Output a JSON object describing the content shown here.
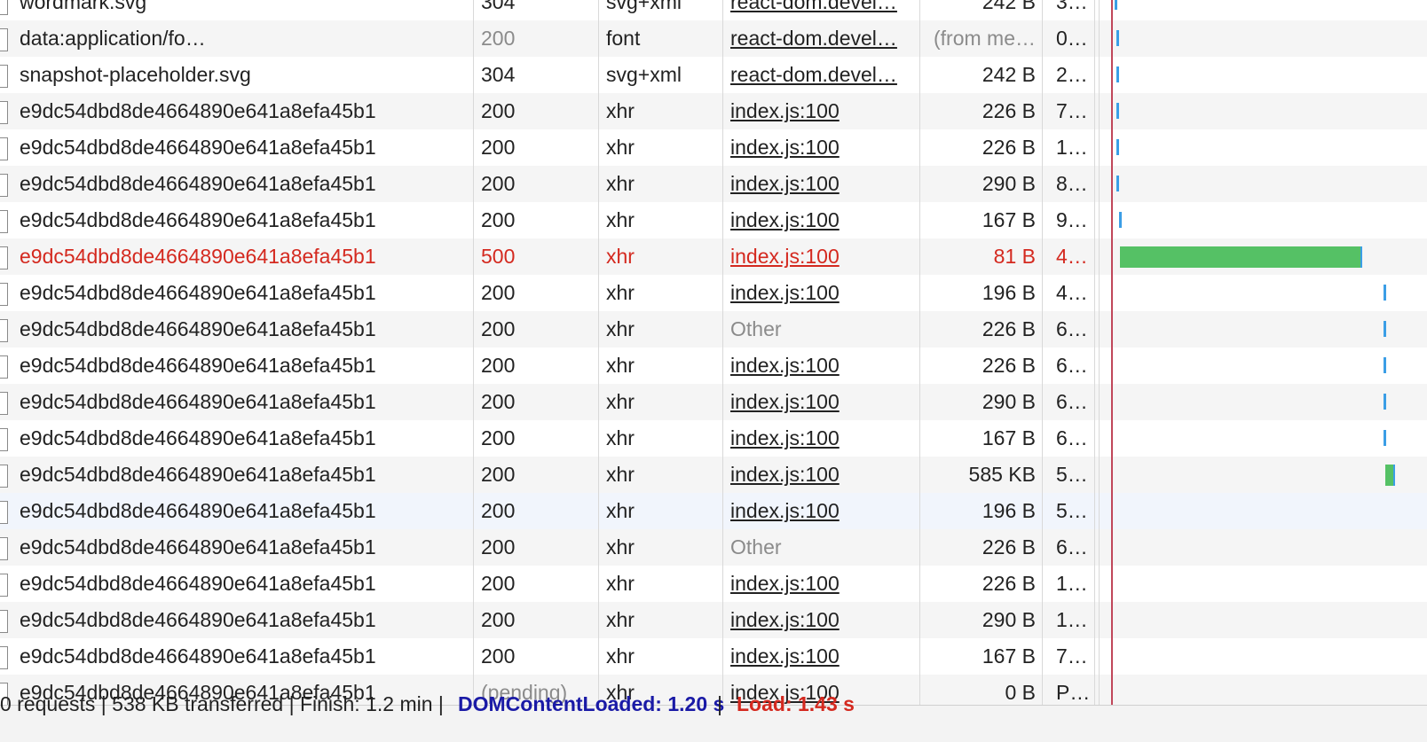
{
  "requests": [
    {
      "name": "wordmark.svg",
      "status": "304",
      "type": "svg+xml",
      "initiator": "react-dom.devel…",
      "size": "242 B",
      "time": "3…"
    },
    {
      "name": "data:application/fo…",
      "status": "200",
      "type": "font",
      "initiator": "react-dom.devel…",
      "size": "(from me…",
      "time": "0…"
    },
    {
      "name": "snapshot-placeholder.svg",
      "status": "304",
      "type": "svg+xml",
      "initiator": "react-dom.devel…",
      "size": "242 B",
      "time": "2…"
    },
    {
      "name": "e9dc54dbd8de4664890e641a8efa45b1",
      "status": "200",
      "type": "xhr",
      "initiator": "index.js:100",
      "size": "226 B",
      "time": "7…"
    },
    {
      "name": "e9dc54dbd8de4664890e641a8efa45b1",
      "status": "200",
      "type": "xhr",
      "initiator": "index.js:100",
      "size": "226 B",
      "time": "1…"
    },
    {
      "name": "e9dc54dbd8de4664890e641a8efa45b1",
      "status": "200",
      "type": "xhr",
      "initiator": "index.js:100",
      "size": "290 B",
      "time": "8…"
    },
    {
      "name": "e9dc54dbd8de4664890e641a8efa45b1",
      "status": "200",
      "type": "xhr",
      "initiator": "index.js:100",
      "size": "167 B",
      "time": "9…"
    },
    {
      "name": "e9dc54dbd8de4664890e641a8efa45b1",
      "status": "500",
      "type": "xhr",
      "initiator": "index.js:100",
      "size": "81 B",
      "time": "4…",
      "error": true
    },
    {
      "name": "e9dc54dbd8de4664890e641a8efa45b1",
      "status": "200",
      "type": "xhr",
      "initiator": "index.js:100",
      "size": "196 B",
      "time": "4…"
    },
    {
      "name": "e9dc54dbd8de4664890e641a8efa45b1",
      "status": "200",
      "type": "xhr",
      "initiator": "Other",
      "size": "226 B",
      "time": "6…"
    },
    {
      "name": "e9dc54dbd8de4664890e641a8efa45b1",
      "status": "200",
      "type": "xhr",
      "initiator": "index.js:100",
      "size": "226 B",
      "time": "6…"
    },
    {
      "name": "e9dc54dbd8de4664890e641a8efa45b1",
      "status": "200",
      "type": "xhr",
      "initiator": "index.js:100",
      "size": "290 B",
      "time": "6…"
    },
    {
      "name": "e9dc54dbd8de4664890e641a8efa45b1",
      "status": "200",
      "type": "xhr",
      "initiator": "index.js:100",
      "size": "167 B",
      "time": "6…"
    },
    {
      "name": "e9dc54dbd8de4664890e641a8efa45b1",
      "status": "200",
      "type": "xhr",
      "initiator": "index.js:100",
      "size": "585 KB",
      "time": "5…"
    },
    {
      "name": "e9dc54dbd8de4664890e641a8efa45b1",
      "status": "200",
      "type": "xhr",
      "initiator": "index.js:100",
      "size": "196 B",
      "time": "5…",
      "selected": true
    },
    {
      "name": "e9dc54dbd8de4664890e641a8efa45b1",
      "status": "200",
      "type": "xhr",
      "initiator": "Other",
      "size": "226 B",
      "time": "6…"
    },
    {
      "name": "e9dc54dbd8de4664890e641a8efa45b1",
      "status": "200",
      "type": "xhr",
      "initiator": "index.js:100",
      "size": "226 B",
      "time": "1…"
    },
    {
      "name": "e9dc54dbd8de4664890e641a8efa45b1",
      "status": "200",
      "type": "xhr",
      "initiator": "index.js:100",
      "size": "290 B",
      "time": "1…"
    },
    {
      "name": "e9dc54dbd8de4664890e641a8efa45b1",
      "status": "200",
      "type": "xhr",
      "initiator": "index.js:100",
      "size": "167 B",
      "time": "7…"
    },
    {
      "name": "e9dc54dbd8de4664890e641a8efa45b1",
      "status": "(pending)",
      "type": "xhr",
      "initiator": "index.js:100",
      "size": "0 B",
      "time": "P…"
    }
  ],
  "footer": {
    "summary": "0 requests | 538 KB transferred | Finish: 1.2 min |",
    "dom_label": "DOMContentLoaded: 1.20 s",
    "separator": "|",
    "load_label": "Load: 1.43 s"
  },
  "colors": {
    "error": "#d4291f",
    "waterfall_blue": "#3b9ee6",
    "waterfall_green": "#55c165",
    "load_line": "#c0475a"
  }
}
